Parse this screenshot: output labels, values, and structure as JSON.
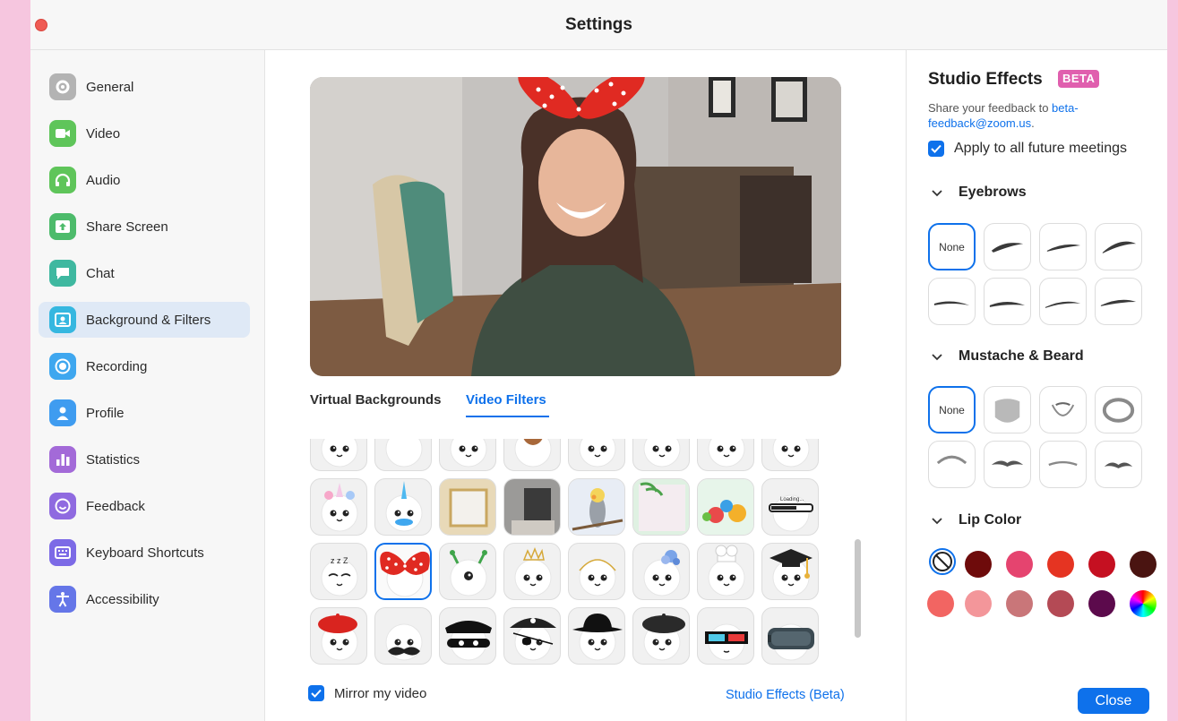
{
  "window": {
    "title": "Settings"
  },
  "sidebar": {
    "items": [
      {
        "label": "General",
        "icon": "gear-icon",
        "color": "#b3b3b3"
      },
      {
        "label": "Video",
        "icon": "video-camera-icon",
        "color": "#5fc55a"
      },
      {
        "label": "Audio",
        "icon": "headphones-icon",
        "color": "#5fc55a"
      },
      {
        "label": "Share Screen",
        "icon": "share-screen-icon",
        "color": "#4dbb6b"
      },
      {
        "label": "Chat",
        "icon": "chat-bubble-icon",
        "color": "#3fb8a0"
      },
      {
        "label": "Background & Filters",
        "icon": "background-person-icon",
        "color": "#35b7e0"
      },
      {
        "label": "Recording",
        "icon": "record-icon",
        "color": "#3fa7ef"
      },
      {
        "label": "Profile",
        "icon": "person-icon",
        "color": "#3f9cf0"
      },
      {
        "label": "Statistics",
        "icon": "bar-chart-icon",
        "color": "#a36ad8"
      },
      {
        "label": "Feedback",
        "icon": "smiley-icon",
        "color": "#8f6ae0"
      },
      {
        "label": "Keyboard Shortcuts",
        "icon": "keyboard-icon",
        "color": "#7c6ae6"
      },
      {
        "label": "Accessibility",
        "icon": "accessibility-icon",
        "color": "#6576e8"
      }
    ],
    "active_index": 5
  },
  "center": {
    "tabs": [
      {
        "label": "Virtual Backgrounds",
        "active": false
      },
      {
        "label": "Video Filters",
        "active": true
      }
    ],
    "mirror_label": "Mirror my video",
    "mirror_checked": true,
    "studio_link": "Studio Effects (Beta)",
    "filter_tiles": [
      [
        "mask-filter-icon",
        "surgical-mask-filter-icon",
        "bear-face-filter-icon",
        "dog-face-filter-icon",
        "goat-face-filter-icon",
        "pig-face-filter-icon",
        "cat-face-filter-icon",
        "bunny-face-filter-icon"
      ],
      [
        "unicorn-filter-icon",
        "narwhal-filter-icon",
        "gold-frame-filter-icon",
        "dark-room-filter-icon",
        "cockatiel-filter-icon",
        "leaves-frame-filter-icon",
        "lollipops-filter-icon",
        "loading-bar-filter-icon"
      ],
      [
        "sleepy-zzz-filter-icon",
        "polka-dot-bow-filter-icon",
        "alien-antenna-filter-icon",
        "tiara-filter-icon",
        "halo-filter-icon",
        "flower-filter-icon",
        "chef-hat-filter-icon",
        "graduation-cap-filter-icon"
      ],
      [
        "red-beret-filter-icon",
        "mustache-filter-icon",
        "bandit-mask-filter-icon",
        "pirate-filter-icon",
        "fedora-filter-icon",
        "black-beret-filter-icon",
        "3d-glasses-filter-icon",
        "vr-headset-filter-icon"
      ]
    ],
    "selected_tile": {
      "row": 2,
      "col": 1
    },
    "loading_text": "Loading..."
  },
  "studio": {
    "title": "Studio Effects",
    "badge": "BETA",
    "feedback_prefix": "Share your feedback to ",
    "feedback_email": "beta-feedback@zoom.us",
    "feedback_suffix": ".",
    "apply_label": "Apply to all future meetings",
    "apply_checked": true,
    "eyebrows_label": "Eyebrows",
    "eyebrows_none": "None",
    "mustache_label": "Mustache & Beard",
    "mustache_none": "None",
    "lip_label": "Lip Color",
    "lip_colors": [
      "#6e0b0b",
      "#e5446f",
      "#e53422",
      "#c51021",
      "#4a1411",
      "#f26562",
      "#f3969a",
      "#c97679",
      "#b44a55",
      "#5c0a4c"
    ],
    "close_label": "Close"
  }
}
